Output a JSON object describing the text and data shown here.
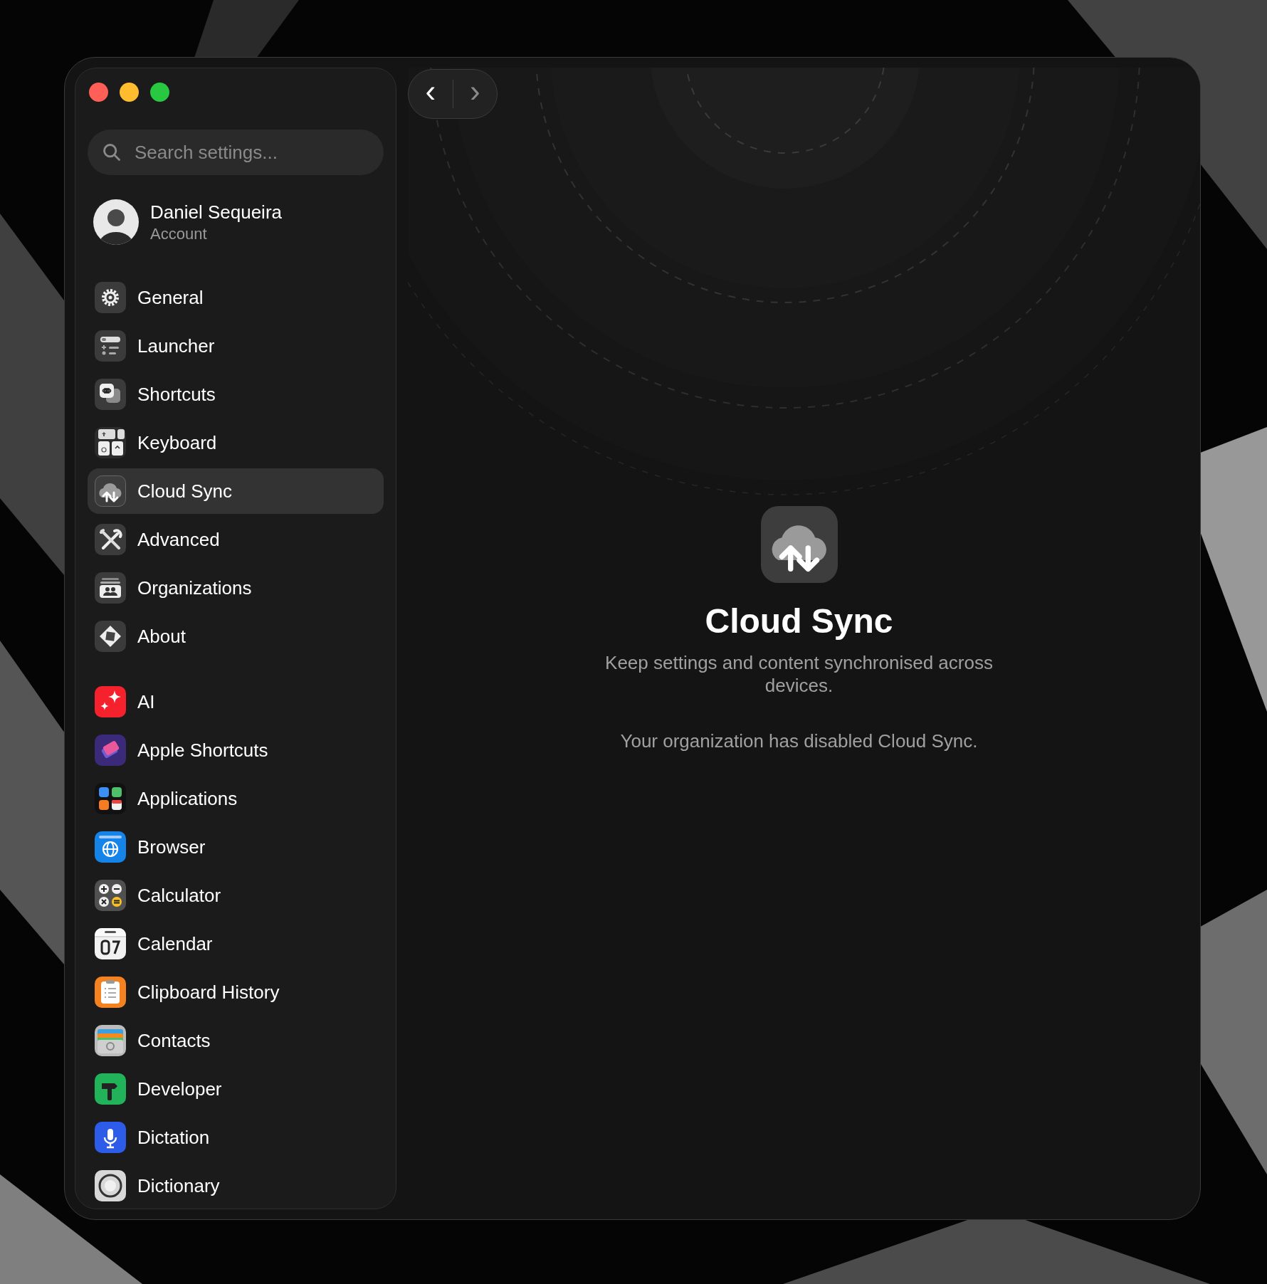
{
  "window": {
    "nav": [
      {
        "label": "‹",
        "disabled": false
      },
      {
        "label": "›",
        "disabled": true
      }
    ]
  },
  "sidebar": {
    "search": {
      "placeholder": "Search settings..."
    },
    "account": {
      "name": "Daniel Sequeira",
      "subtitle": "Account"
    },
    "sections": [
      {
        "items": [
          {
            "label": "General",
            "selected": false
          },
          {
            "label": "Launcher",
            "selected": false
          },
          {
            "label": "Shortcuts",
            "selected": false
          },
          {
            "label": "Keyboard",
            "selected": false
          },
          {
            "label": "Cloud Sync",
            "selected": true
          },
          {
            "label": "Advanced",
            "selected": false
          },
          {
            "label": "Organizations",
            "selected": false
          },
          {
            "label": "About",
            "selected": false
          }
        ]
      },
      {
        "items": [
          {
            "label": "AI",
            "selected": false
          },
          {
            "label": "Apple Shortcuts",
            "selected": false
          },
          {
            "label": "Applications",
            "selected": false
          },
          {
            "label": "Browser",
            "selected": false
          },
          {
            "label": "Calculator",
            "selected": false
          },
          {
            "label": "Calendar",
            "selected": false
          },
          {
            "label": "Clipboard History",
            "selected": false
          },
          {
            "label": "Contacts",
            "selected": false
          },
          {
            "label": "Developer",
            "selected": false
          },
          {
            "label": "Dictation",
            "selected": false
          },
          {
            "label": "Dictionary",
            "selected": false
          }
        ]
      }
    ]
  },
  "main": {
    "title": "Cloud Sync",
    "description": "Keep settings and content synchronised across devices.",
    "notice": "Your organization has disabled Cloud Sync."
  }
}
